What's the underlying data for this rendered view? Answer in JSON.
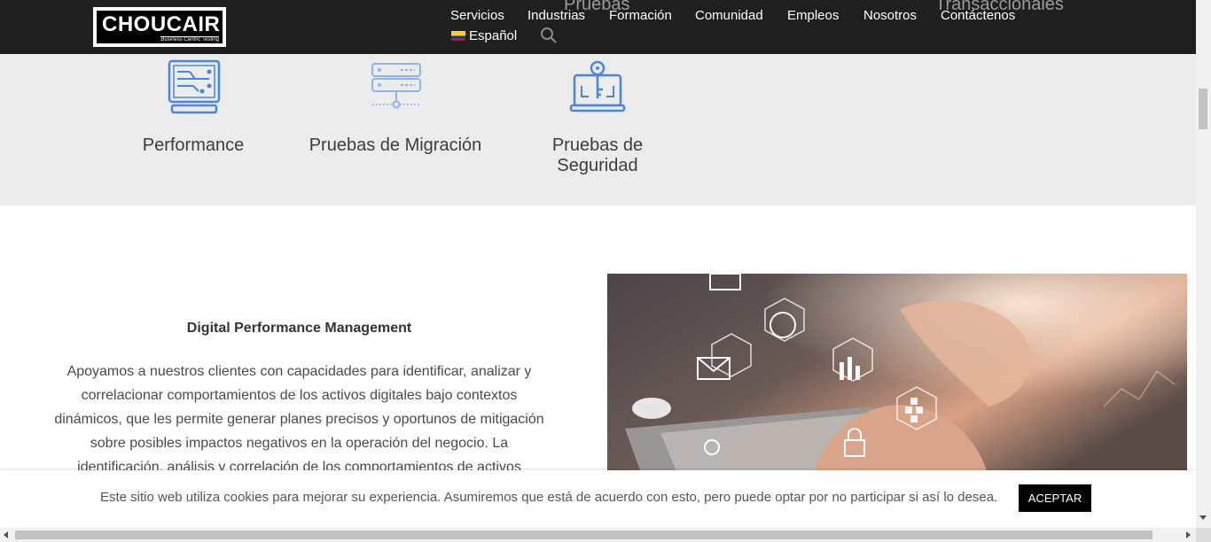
{
  "header": {
    "logo": {
      "name": "CHOUCAIR",
      "tagline": "Business Centric Testing"
    },
    "ghost_texts": [
      "Pruebas",
      "Transaccionales"
    ],
    "nav": [
      "Servicios",
      "Industrias",
      "Formación",
      "Comunidad",
      "Empleos",
      "Nosotros",
      "Contáctenos"
    ],
    "language": "Español",
    "icons": {
      "search": "search-icon",
      "flag": "colombia-flag-icon"
    }
  },
  "services": [
    {
      "title": "Performance",
      "icon": "server-circuit-icon"
    },
    {
      "title": "Pruebas de Migración",
      "icon": "database-migration-icon"
    },
    {
      "title": "Pruebas de Seguridad",
      "title_lines": [
        "Pruebas de",
        "Seguridad"
      ],
      "icon": "laptop-key-icon"
    }
  ],
  "content": {
    "heading": "Digital Performance Management",
    "paragraph": "Apoyamos a nuestros clientes con capacidades para identificar, analizar y correlacionar comportamientos de los activos digitales bajo contextos dinámicos, que les permite generar planes precisos y oportunos de mitigación sobre posibles impactos negativos en la operación del negocio. La identificación, análisis y correlación de los comportamientos de activos",
    "image": "laptop-hands-digital-icons-photo"
  },
  "cookie": {
    "text": "Este sitio web utiliza cookies para mejorar su experiencia. Asumiremos que está de acuerdo con esto, pero puede optar por no participar si así lo desea.",
    "button": "ACEPTAR"
  },
  "colors": {
    "header_bg": "#1f1f1f",
    "band_bg": "#ececec",
    "icon_blue": "#4a86e0",
    "button_bg": "#000000"
  }
}
